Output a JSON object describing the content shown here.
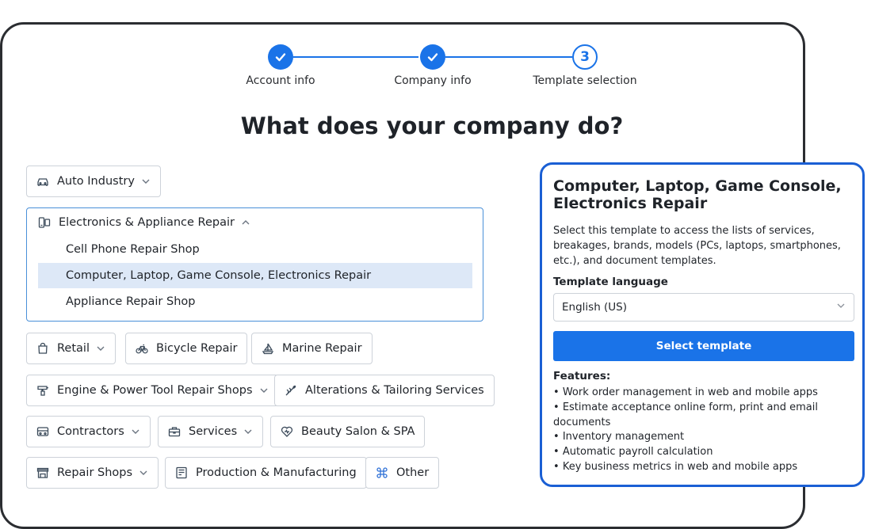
{
  "stepper": {
    "steps": [
      {
        "label": "Account info",
        "state": "done"
      },
      {
        "label": "Company info",
        "state": "done"
      },
      {
        "label": "Template selection",
        "state": "current",
        "number": "3"
      }
    ]
  },
  "heading": "What does your company do?",
  "categories": {
    "auto": {
      "label": "Auto Industry",
      "icon": "car-icon",
      "has_dropdown": true
    },
    "electronics": {
      "label": "Electronics & Appliance Repair",
      "icon": "devices-icon",
      "expanded": true,
      "items": [
        "Cell Phone Repair Shop",
        "Computer, Laptop, Game Console, Electronics Repair",
        "Appliance Repair Shop"
      ],
      "selected_index": 1
    },
    "retail": {
      "label": "Retail",
      "icon": "shopping-bag-icon",
      "has_dropdown": true
    },
    "bicycle": {
      "label": "Bicycle Repair",
      "icon": "bicycle-icon"
    },
    "marine": {
      "label": "Marine Repair",
      "icon": "sailboat-icon"
    },
    "engine": {
      "label": "Engine & Power Tool Repair Shops",
      "icon": "power-tool-icon",
      "has_dropdown": true
    },
    "alterations": {
      "label": "Alterations & Tailoring Services",
      "icon": "needle-icon"
    },
    "contractors": {
      "label": "Contractors",
      "icon": "truck-icon",
      "has_dropdown": true
    },
    "services": {
      "label": "Services",
      "icon": "toolbox-icon",
      "has_dropdown": true
    },
    "beauty": {
      "label": "Beauty Salon & SPA",
      "icon": "heart-icon"
    },
    "repair_shops": {
      "label": "Repair Shops",
      "icon": "store-icon",
      "has_dropdown": true
    },
    "production": {
      "label": "Production & Manufacturing",
      "icon": "factory-icon"
    },
    "other": {
      "label": "Other",
      "icon": "command-icon"
    }
  },
  "panel": {
    "title": "Computer, Laptop, Game Console, Electronics Repair",
    "description": "Select this template to access the lists of services, breakages, brands, models (PCs, laptops, smartphones, etc.), and document templates.",
    "language_label": "Template language",
    "language_value": "English (US)",
    "select_button": "Select template",
    "features_title": "Features:",
    "features": [
      "Work order management in web and mobile apps",
      "Estimate acceptance online form, print and email documents",
      "Inventory management",
      "Automatic payroll calculation",
      "Key business metrics in web and mobile apps"
    ]
  },
  "colors": {
    "accent": "#1a73e8",
    "panel_border": "#1a5fd4",
    "selected_row": "#dde8f7"
  }
}
